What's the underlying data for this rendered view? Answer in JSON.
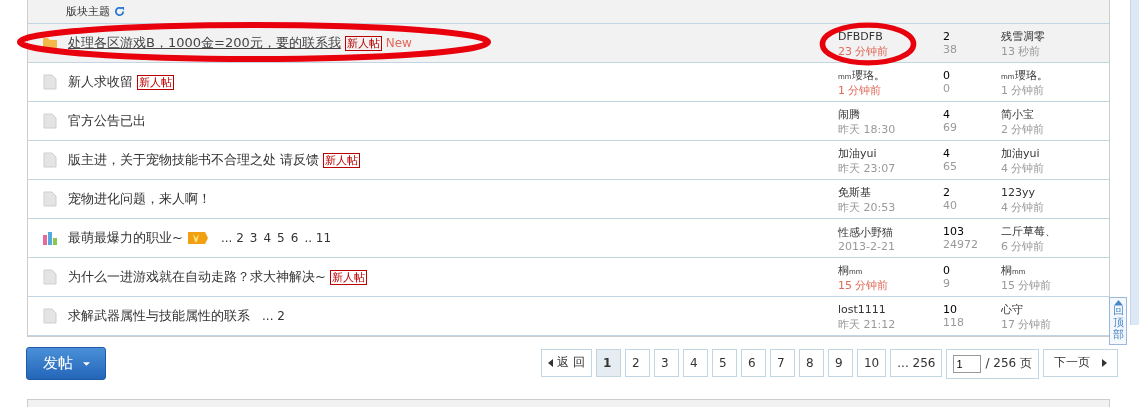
{
  "table": {
    "header": "版块主题",
    "rows": [
      {
        "kind": "new",
        "title": "处理各区游戏B，1000金=200元，要的联系我",
        "hovered": true,
        "circled_title": true,
        "circled_author": true,
        "badges": [
          {
            "kind": "newbie",
            "text": "新人帖"
          },
          {
            "kind": "new",
            "text": "New"
          }
        ],
        "pages": [],
        "author": "DFBDFB",
        "author_time": "23 分钟前",
        "recent": true,
        "replies": "2",
        "views": "38",
        "last_user": "残雪凋零",
        "last_time": "13 秒前"
      },
      {
        "kind": "normal",
        "title": "新人求收留",
        "hovered": false,
        "circled_title": false,
        "circled_author": false,
        "badges": [
          {
            "kind": "newbie",
            "text": "新人帖"
          }
        ],
        "pages": [],
        "author": "ₘₘ瓔珞。",
        "author_time": "1 分钟前",
        "recent": true,
        "replies": "0",
        "views": "0",
        "last_user": "ₘₘ瓔珞。",
        "last_time": "1 分钟前"
      },
      {
        "kind": "normal",
        "title": "官方公告已出",
        "hovered": false,
        "circled_title": false,
        "circled_author": false,
        "badges": [],
        "pages": [],
        "author": "闹腾",
        "author_time": "昨天 18:30",
        "recent": false,
        "replies": "4",
        "views": "69",
        "last_user": "简小宝",
        "last_time": "2 分钟前"
      },
      {
        "kind": "normal",
        "title": "版主进，关于宠物技能书不合理之处 请反馈",
        "hovered": false,
        "circled_title": false,
        "circled_author": false,
        "badges": [
          {
            "kind": "newbie",
            "text": "新人帖"
          }
        ],
        "pages": [],
        "author": "加油yui",
        "author_time": "昨天 23:07",
        "recent": false,
        "replies": "4",
        "views": "65",
        "last_user": "加油yui",
        "last_time": "4 分钟前"
      },
      {
        "kind": "normal",
        "title": "宠物进化问题，来人啊！",
        "hovered": false,
        "circled_title": false,
        "circled_author": false,
        "badges": [],
        "pages": [],
        "author": "免斯基",
        "author_time": "昨天 20:53",
        "recent": false,
        "replies": "2",
        "views": "40",
        "last_user": "123yy",
        "last_time": "4 分钟前"
      },
      {
        "kind": "hot",
        "title": "最萌最爆力的职业~",
        "hovered": false,
        "circled_title": false,
        "circled_author": false,
        "badges": [
          {
            "kind": "hot"
          }
        ],
        "pages": [
          "... 2",
          "3",
          "4",
          "5",
          "6",
          ".. 11"
        ],
        "author": "性感小野猫",
        "author_time": "2013-2-21",
        "recent": false,
        "replies": "103",
        "views": "24972",
        "last_user": "二斤草莓、",
        "last_time": "6 分钟前"
      },
      {
        "kind": "normal",
        "title": "为什么一进游戏就在自动走路？求大神解决~",
        "hovered": false,
        "circled_title": false,
        "circled_author": false,
        "badges": [
          {
            "kind": "newbie",
            "text": "新人帖"
          }
        ],
        "pages": [],
        "author": "桐ₘₘ",
        "author_time": "15 分钟前",
        "recent": true,
        "replies": "0",
        "views": "9",
        "last_user": "桐ₘₘ",
        "last_time": "15 分钟前"
      },
      {
        "kind": "normal",
        "title": "求解武器属性与技能属性的联系",
        "hovered": false,
        "circled_title": false,
        "circled_author": false,
        "badges": [],
        "pages": [
          "... 2"
        ],
        "author": "lost1111",
        "author_time": "昨天 21:12",
        "recent": false,
        "replies": "10",
        "views": "118",
        "last_user": "心守",
        "last_time": "17 分钟前"
      }
    ]
  },
  "back_to_top": "回顶部",
  "post_button": "发帖",
  "pagination": {
    "back": "返 回",
    "pages": [
      {
        "label": "1",
        "selected": true
      },
      {
        "label": "2",
        "selected": false
      },
      {
        "label": "3",
        "selected": false
      },
      {
        "label": "4",
        "selected": false
      },
      {
        "label": "5",
        "selected": false
      },
      {
        "label": "6",
        "selected": false
      },
      {
        "label": "7",
        "selected": false
      },
      {
        "label": "8",
        "selected": false
      },
      {
        "label": "9",
        "selected": false
      },
      {
        "label": "10",
        "selected": false
      },
      {
        "label": "... 256",
        "selected": false
      }
    ],
    "jump_value": "1",
    "total": "/ 256 页",
    "next": "下一页"
  }
}
